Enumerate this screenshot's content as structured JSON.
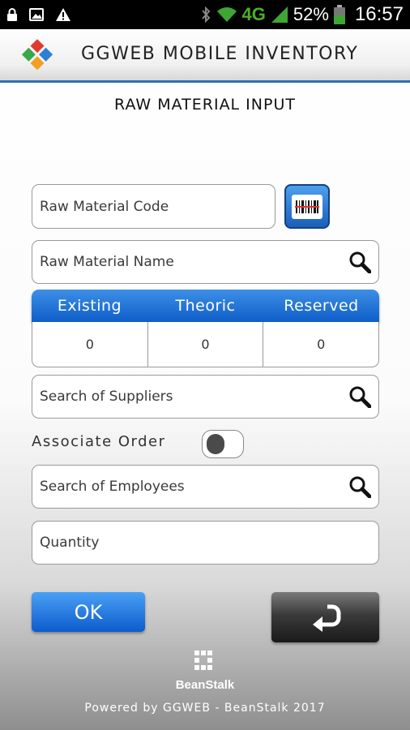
{
  "status_bar": {
    "icons": [
      "lock-icon",
      "image-icon",
      "warning-icon",
      "bluetooth-icon",
      "wifi-icon",
      "signal-icon",
      "battery-icon"
    ],
    "network": "4G",
    "battery": "52%",
    "clock": "16:57"
  },
  "header": {
    "app_title": "GGWEB MOBILE INVENTORY",
    "accent_color": "#2f6fb4"
  },
  "page": {
    "title": "RAW MATERIAL INPUT"
  },
  "form": {
    "raw_material_code": {
      "placeholder": "Raw Material Code",
      "value": ""
    },
    "raw_material_name": {
      "placeholder": "Raw Material Name",
      "value": ""
    },
    "stock": {
      "columns": [
        "Existing",
        "Theoric",
        "Reserved"
      ],
      "values": [
        "0",
        "0",
        "0"
      ]
    },
    "suppliers": {
      "placeholder": "Search of Suppliers",
      "value": ""
    },
    "associate_order": {
      "label": "Associate Order",
      "checked": false
    },
    "employees": {
      "placeholder": "Search of Employees",
      "value": ""
    },
    "quantity": {
      "placeholder": "Quantity",
      "value": ""
    }
  },
  "actions": {
    "ok_label": "OK",
    "back_icon": "undo-arrow-icon"
  },
  "branding": {
    "name": "BeanStalk",
    "footer": "Powered by GGWEB - BeanStalk 2017"
  },
  "colors": {
    "primary_blue": "#1a6fd6",
    "dark_button": "#2a2a2a"
  }
}
